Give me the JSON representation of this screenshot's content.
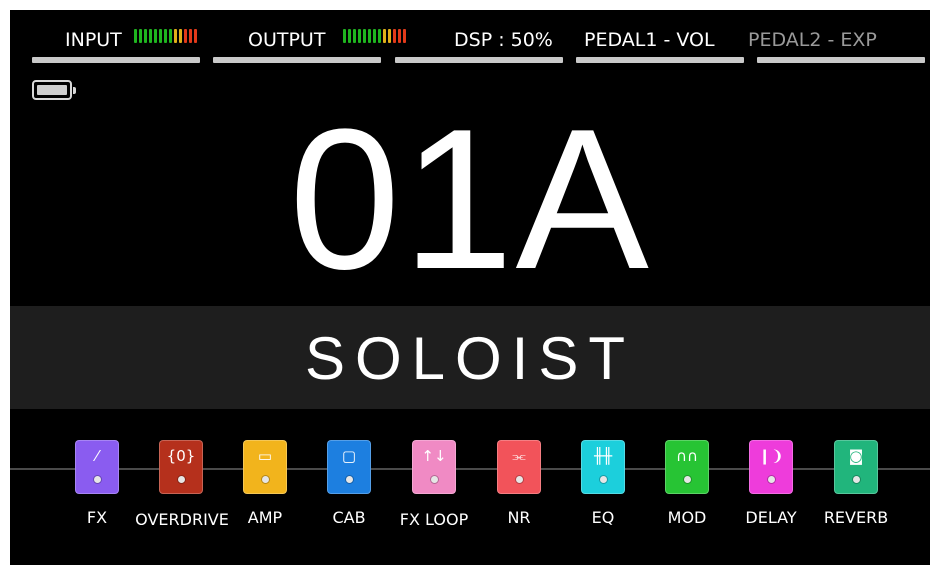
{
  "status": {
    "input_label": "INPUT",
    "output_label": "OUTPUT",
    "dsp_label": "DSP : 50%",
    "pedal1_label": "PEDAL1 - VOL",
    "pedal2_label": "PEDAL2 - EXP",
    "meter_colors": [
      "#1fb51f",
      "#1fb51f",
      "#1fb51f",
      "#1fb51f",
      "#1fb51f",
      "#1fb51f",
      "#1fb51f",
      "#1fb51f",
      "#e2b019",
      "#e2b019",
      "#e23a1a",
      "#e23a1a",
      "#e23a1a"
    ],
    "dim_color": "#9a9a9a"
  },
  "battery": {
    "icon": "battery-icon"
  },
  "preset": {
    "number": "01A",
    "name": "SOLOIST"
  },
  "chain": {
    "modules": [
      {
        "label": "FX",
        "icon": "fx-icon",
        "glyph": "⁄",
        "color": "#8a5cf0"
      },
      {
        "label": "OVERDRIVE",
        "icon": "overdrive-icon",
        "glyph": "{0}",
        "color": "#b5301c"
      },
      {
        "label": "AMP",
        "icon": "amp-icon",
        "glyph": "▭",
        "color": "#f2b41c"
      },
      {
        "label": "CAB",
        "icon": "cab-icon",
        "glyph": "▢",
        "color": "#1d7fe0"
      },
      {
        "label": "FX LOOP",
        "icon": "fx-loop-icon",
        "glyph": "↑↓",
        "color": "#f08ac4"
      },
      {
        "label": "NR",
        "icon": "nr-icon",
        "glyph": "⫘",
        "color": "#f2535a"
      },
      {
        "label": "EQ",
        "icon": "eq-icon",
        "glyph": "╫╫",
        "color": "#1ccfdc"
      },
      {
        "label": "MOD",
        "icon": "mod-icon",
        "glyph": "∩∩",
        "color": "#27c434"
      },
      {
        "label": "DELAY",
        "icon": "delay-icon",
        "glyph": "❙❩",
        "color": "#ee3cdb"
      },
      {
        "label": "REVERB",
        "icon": "reverb-icon",
        "glyph": "◙",
        "color": "#21b57c"
      }
    ]
  }
}
